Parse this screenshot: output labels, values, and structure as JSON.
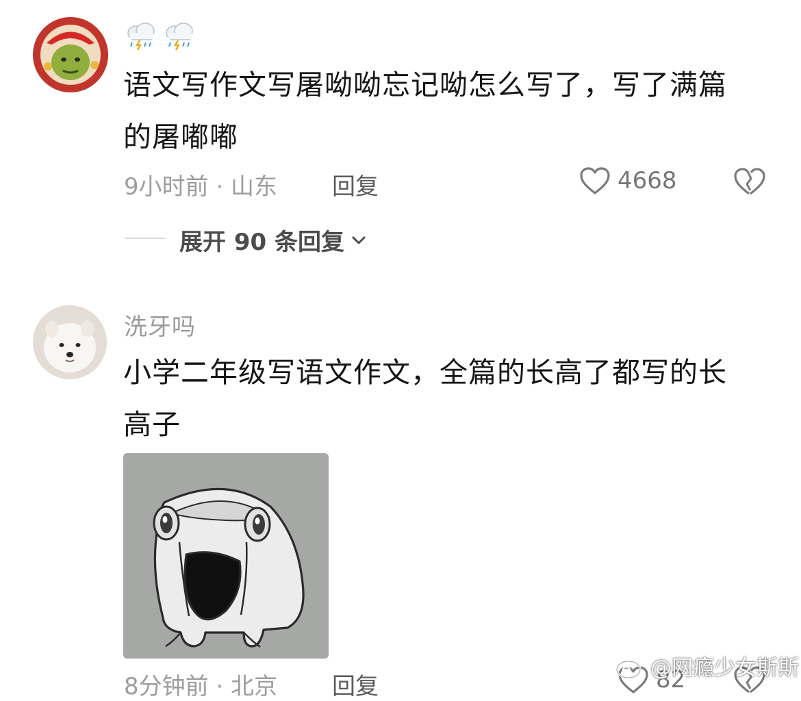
{
  "comments": [
    {
      "username": "",
      "username_icons": [
        "thunderstorm-cloud-icon",
        "thunderstorm-cloud-icon"
      ],
      "text_lines": [
        "语文写作文写屠呦呦忘记呦怎么写了，写了满篇",
        "的屠嘟嘟"
      ],
      "time_location": "9小时前 · 山东",
      "reply_label": "回复",
      "likes": "4668",
      "expand_replies": "展开 90 条回复"
    },
    {
      "username": "洗牙吗",
      "text_lines": [
        "小学二年级写语文作文，全篇的长高了都写的长",
        "高子"
      ],
      "time_location": "8分钟前 · 北京",
      "reply_label": "回复",
      "likes": "82"
    }
  ],
  "watermark": "@网瘾少女斯斯",
  "colors": {
    "text_primary": "#161616",
    "text_meta": "#9d9d9d",
    "divider": "#dcdcdc",
    "image_bg": "#a6a8a6"
  }
}
